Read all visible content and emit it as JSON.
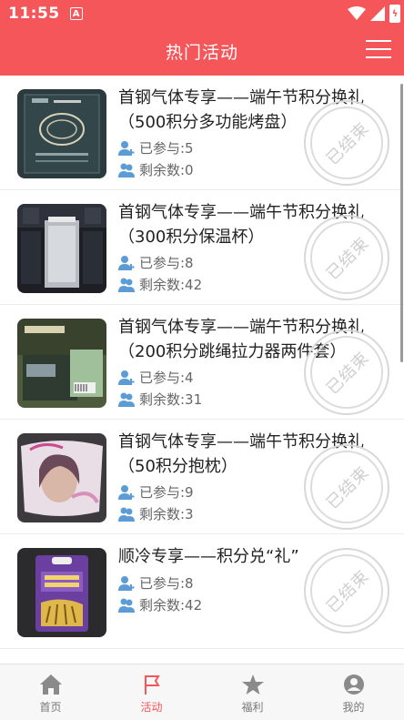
{
  "status": {
    "time": "11:55",
    "notif_badge": "A"
  },
  "header": {
    "title": "热门活动"
  },
  "items": [
    {
      "title": "首钢气体专享——端午节积分换礼（500积分多功能烤盘）",
      "joined": "已参与:5",
      "remaining": "剩余数:0",
      "stamp": "已结束"
    },
    {
      "title": "首钢气体专享——端午节积分换礼（300积分保温杯）",
      "joined": "已参与:8",
      "remaining": "剩余数:42",
      "stamp": "已结束"
    },
    {
      "title": "首钢气体专享——端午节积分换礼（200积分跳绳拉力器两件套）",
      "joined": "已参与:4",
      "remaining": "剩余数:31",
      "stamp": "已结束"
    },
    {
      "title": "首钢气体专享——端午节积分换礼（50积分抱枕）",
      "joined": "已参与:9",
      "remaining": "剩余数:3",
      "stamp": "已结束"
    },
    {
      "title": "顺冷专享——积分兑“礼”",
      "joined": "已参与:8",
      "remaining": "剩余数:42",
      "stamp": "已结束"
    }
  ],
  "tabs": [
    {
      "label": "首页",
      "icon": "home-icon"
    },
    {
      "label": "活动",
      "icon": "flag-icon",
      "active": true
    },
    {
      "label": "福利",
      "icon": "star-icon"
    },
    {
      "label": "我的",
      "icon": "user-icon"
    }
  ],
  "colors": {
    "accent": "#f5565a",
    "meta_icon": "#5b9cd6",
    "stamp": "#d8d8d8"
  }
}
